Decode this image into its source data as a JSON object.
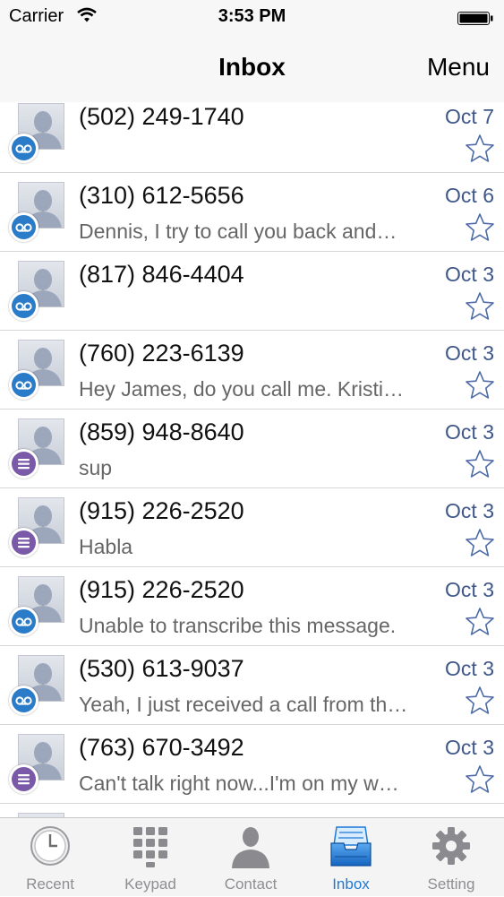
{
  "status_bar": {
    "carrier": "Carrier",
    "time": "3:53 PM"
  },
  "nav": {
    "title": "Inbox",
    "menu_label": "Menu"
  },
  "messages": [
    {
      "phone": "(502) 249-1740",
      "date": "Oct 7",
      "preview": "",
      "type": "voicemail-icon"
    },
    {
      "phone": "(310) 612-5656",
      "date": "Oct 6",
      "preview": "Dennis, I try to call you back and…",
      "type": "voicemail-icon"
    },
    {
      "phone": "(817) 846-4404",
      "date": "Oct 3",
      "preview": "",
      "type": "voicemail-icon"
    },
    {
      "phone": "(760) 223-6139",
      "date": "Oct 3",
      "preview": "Hey James, do you call me. Kristi…",
      "type": "voicemail-icon"
    },
    {
      "phone": "(859) 948-8640",
      "date": "Oct 3",
      "preview": "sup",
      "type": "text-message-icon"
    },
    {
      "phone": "(915) 226-2520",
      "date": "Oct 3",
      "preview": "Habla",
      "type": "text-message-icon"
    },
    {
      "phone": "(915) 226-2520",
      "date": "Oct 3",
      "preview": "Unable to transcribe this message.",
      "type": "voicemail-icon"
    },
    {
      "phone": "(530) 613-9037",
      "date": "Oct 3",
      "preview": "Yeah, I just received a call from th…",
      "type": "voicemail-icon"
    },
    {
      "phone": "(763) 670-3492",
      "date": "Oct 3",
      "preview": "Can't talk right now...I'm on my w…",
      "type": "text-message-icon"
    }
  ],
  "tabs": [
    {
      "label": "Recent",
      "icon": "clock-icon",
      "active": false
    },
    {
      "label": "Keypad",
      "icon": "keypad-icon",
      "active": false
    },
    {
      "label": "Contact",
      "icon": "person-icon",
      "active": false
    },
    {
      "label": "Inbox",
      "icon": "inbox-tray-icon",
      "active": true
    },
    {
      "label": "Setting",
      "icon": "gear-icon",
      "active": false
    }
  ],
  "colors": {
    "accent": "#1e7ad6",
    "date_text": "#40578a",
    "voicemail_badge": "#2a7cc8",
    "text_badge": "#7a59a8"
  }
}
